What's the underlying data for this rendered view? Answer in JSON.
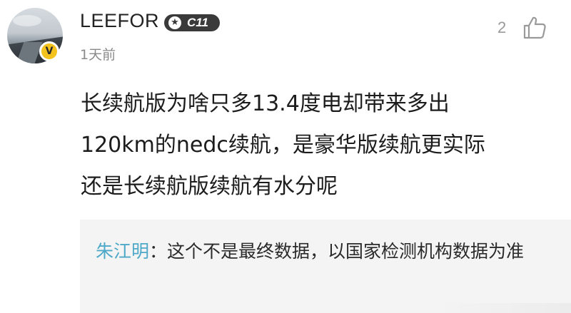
{
  "comment": {
    "username": "LEEFOR",
    "level_badge": "C11",
    "verified_badge": "V",
    "timestamp": "1天前",
    "like_count": "2",
    "body_lines": [
      "长续航版为啥只多13.4度电却带来多出",
      "120km的nedc续航，是豪华版续航更实际",
      "还是长续航版续航有水分呢"
    ]
  },
  "reply": {
    "author": "朱江明",
    "separator": "：",
    "text": "这个不是最终数据，以国家检测机构数据为准"
  },
  "icons": {
    "level_star": "star-icon",
    "like": "thumbs-up-icon"
  },
  "colors": {
    "reply_author": "#4ea8c8",
    "verified_badge": "#f4c21d",
    "level_badge": "#3a3a3a"
  }
}
